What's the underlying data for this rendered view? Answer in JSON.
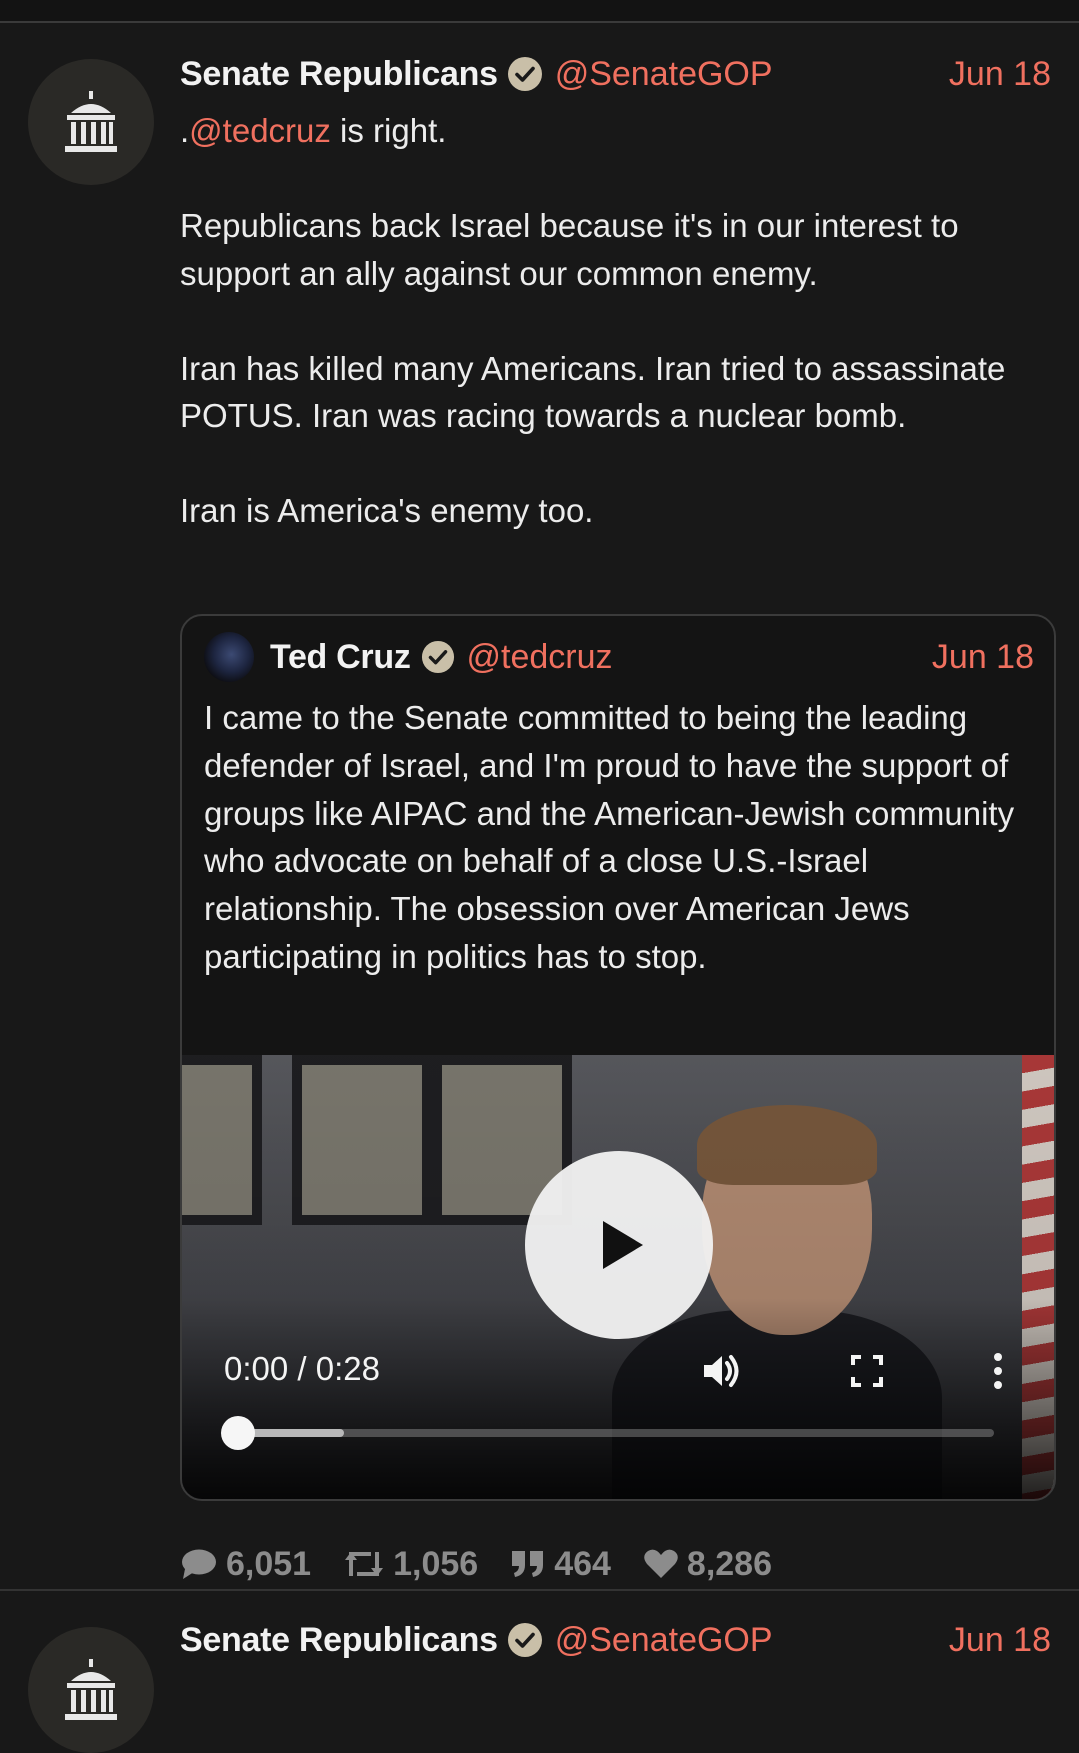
{
  "colors": {
    "background": "#181818",
    "accent": "#f0705f",
    "text": "#ececec",
    "muted": "#8c8c8c"
  },
  "tweets": [
    {
      "author": {
        "name": "Senate Republicans",
        "handle": "@SenateGOP",
        "verified": true,
        "avatar_icon": "capitol-dome-icon"
      },
      "date": "Jun 18",
      "body": {
        "line1_prefix": ".",
        "line1_mention": "@tedcruz",
        "line1_suffix": " is right.",
        "paragraphs": [
          "Republicans back Israel because it's in our interest to support an ally against our common enemy.",
          "Iran has killed many Americans. Iran tried to assassinate POTUS. Iran was racing towards a nuclear bomb.",
          "Iran is America's enemy too."
        ]
      },
      "quote": {
        "author": {
          "name": "Ted Cruz",
          "handle": "@tedcruz",
          "verified": true
        },
        "date": "Jun 18",
        "text": "I came to the Senate committed to being the leading defender of Israel, and I'm proud to have the support of groups like AIPAC and the American-Jewish community who advocate on behalf of a close U.S.-Israel relationship. The obsession over American Jews participating in politics has to stop.",
        "video": {
          "time_display": "0:00 / 0:28",
          "progress": 0,
          "buffered": 0.14,
          "icons": [
            "play-icon",
            "volume-icon",
            "fullscreen-icon",
            "more-options-icon"
          ]
        }
      },
      "stats": {
        "replies": "6,051",
        "retweets": "1,056",
        "quotes": "464",
        "likes": "8,286"
      }
    },
    {
      "author": {
        "name": "Senate Republicans",
        "handle": "@SenateGOP",
        "verified": true,
        "avatar_icon": "capitol-dome-icon"
      },
      "date": "Jun 18"
    }
  ]
}
